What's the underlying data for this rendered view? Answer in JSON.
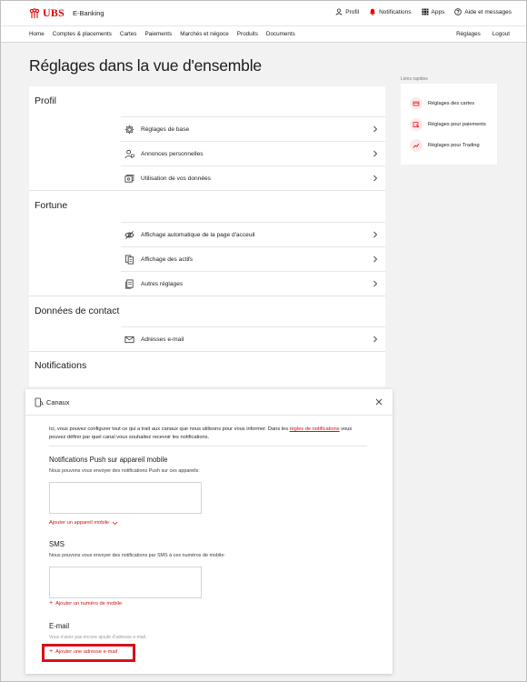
{
  "brand": {
    "logo": "UBS",
    "product": "E-Banking"
  },
  "top_links": [
    {
      "icon": "user-icon",
      "label": "Profil"
    },
    {
      "icon": "bell-icon",
      "label": "Notifications"
    },
    {
      "icon": "apps-grid-icon",
      "label": "Apps"
    },
    {
      "icon": "help-icon",
      "label": "Aide et messages"
    }
  ],
  "nav": {
    "left": [
      "Home",
      "Comptes & placements",
      "Cartes",
      "Paiements",
      "Marchés et négoce",
      "Produits",
      "Documents"
    ],
    "right": [
      "Réglages",
      "Logout"
    ]
  },
  "page_title": "Réglages dans la vue d'ensemble",
  "sections": [
    {
      "title": "Profil",
      "items": [
        {
          "icon": "gear-icon",
          "label": "Réglages de base"
        },
        {
          "icon": "person-ad-icon",
          "label": "Annonces personnelles"
        },
        {
          "icon": "data-usage-icon",
          "label": "Utilisation de vos données"
        }
      ]
    },
    {
      "title": "Fortune",
      "items": [
        {
          "icon": "eye-off-icon",
          "label": "Affichage automatique de la page d'acceuil"
        },
        {
          "icon": "assets-icon",
          "label": "Affichage des actifs"
        },
        {
          "icon": "document-stack-icon",
          "label": "Autres réglages"
        }
      ]
    },
    {
      "title": "Données de contact",
      "items": [
        {
          "icon": "envelope-icon",
          "label": "Adresses e-mail"
        }
      ]
    },
    {
      "title": "Notifications",
      "items": []
    }
  ],
  "quick_links": {
    "label": "Liens rapides",
    "items": [
      {
        "icon": "card-settings-icon",
        "label": "Réglages des cartes"
      },
      {
        "icon": "payment-settings-icon",
        "label": "Réglages pour paiements"
      },
      {
        "icon": "trading-chart-icon",
        "label": "Réglages pour Trading"
      }
    ]
  },
  "modal": {
    "title": "Canaux",
    "intro_before": "Ici, vous pouvez configurer tout ce qui a trait aux canaux que nous utilisons pour vous informer. Dans les ",
    "intro_link": "règles de notifications",
    "intro_after": " vous pouvez définir par quel canal vous souhaitez recevoir les notifications.",
    "push": {
      "title": "Notifications Push sur appareil mobile",
      "desc": "Nous pouvons vous envoyer des notifications Push sur ces appareils:",
      "add": "Ajouter un appareil mobile"
    },
    "sms": {
      "title": "SMS",
      "desc": "Nous pouvons vous envoyer des notifications par SMS à ces numéros de mobile:",
      "add": "Ajouter un numéro de mobile"
    },
    "email": {
      "title": "E-mail",
      "desc": "Vous n'avez pas encore ajouté d'adresse e-mail.",
      "add": "Ajouter une adresse e-mail"
    }
  },
  "colors": {
    "accent": "#e60000",
    "link": "#d01010",
    "highlight": "#d8101c"
  }
}
